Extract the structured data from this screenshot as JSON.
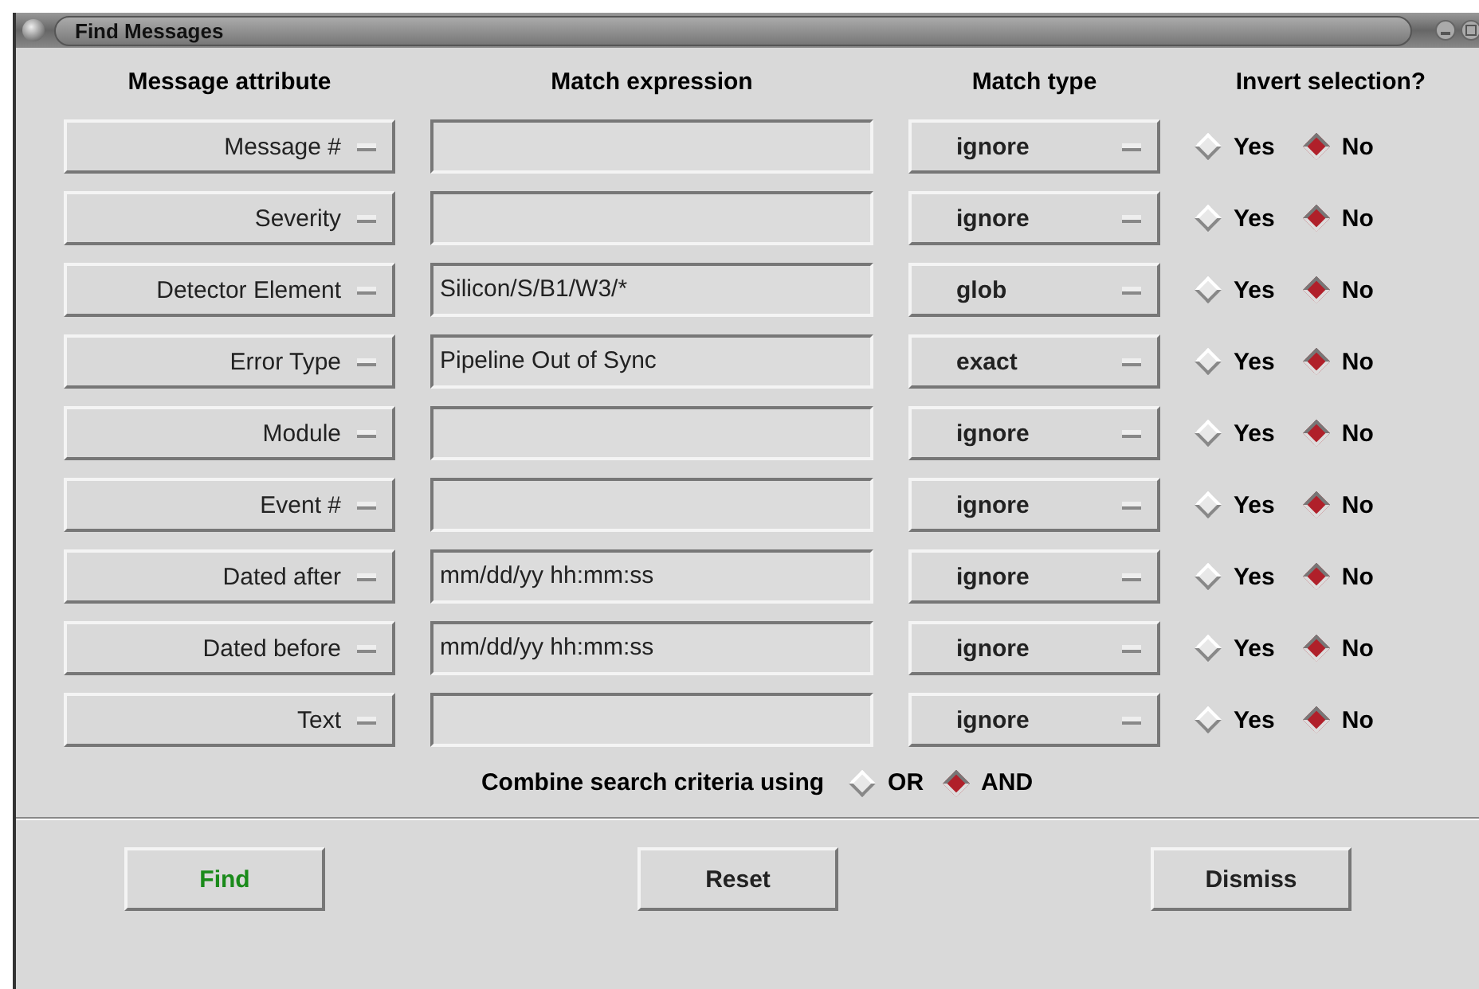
{
  "window": {
    "title": "Find Messages"
  },
  "headers": [
    "Message attribute",
    "Match expression",
    "Match type",
    "Invert selection?"
  ],
  "rows": [
    {
      "attribute": "Message #",
      "expression": "",
      "match_type": "ignore",
      "invert": [
        {
          "label": "Yes",
          "selected": false
        },
        {
          "label": "No",
          "selected": true
        }
      ]
    },
    {
      "attribute": "Severity",
      "expression": "",
      "match_type": "ignore",
      "invert": [
        {
          "label": "Yes",
          "selected": false
        },
        {
          "label": "No",
          "selected": true
        }
      ]
    },
    {
      "attribute": "Detector Element",
      "expression": "Silicon/S/B1/W3/*",
      "match_type": "glob",
      "invert": [
        {
          "label": "Yes",
          "selected": false
        },
        {
          "label": "No",
          "selected": true
        }
      ]
    },
    {
      "attribute": "Error Type",
      "expression": "Pipeline Out of Sync",
      "match_type": "exact",
      "invert": [
        {
          "label": "Yes",
          "selected": false
        },
        {
          "label": "No",
          "selected": true
        }
      ]
    },
    {
      "attribute": "Module",
      "expression": "",
      "match_type": "ignore",
      "invert": [
        {
          "label": "Yes",
          "selected": false
        },
        {
          "label": "No",
          "selected": true
        }
      ]
    },
    {
      "attribute": "Event #",
      "expression": "",
      "match_type": "ignore",
      "invert": [
        {
          "label": "Yes",
          "selected": false
        },
        {
          "label": "No",
          "selected": true
        }
      ]
    },
    {
      "attribute": "Dated after",
      "expression": "mm/dd/yy hh:mm:ss",
      "match_type": "ignore",
      "invert": [
        {
          "label": "Yes",
          "selected": false
        },
        {
          "label": "No",
          "selected": true
        }
      ]
    },
    {
      "attribute": "Dated before",
      "expression": "mm/dd/yy hh:mm:ss",
      "match_type": "ignore",
      "invert": [
        {
          "label": "Yes",
          "selected": false
        },
        {
          "label": "No",
          "selected": true
        }
      ]
    },
    {
      "attribute": "Text",
      "expression": "",
      "match_type": "ignore",
      "invert": [
        {
          "label": "Yes",
          "selected": false
        },
        {
          "label": "No",
          "selected": true
        }
      ]
    }
  ],
  "combine": {
    "label": "Combine search criteria using",
    "options": [
      {
        "label": "OR",
        "selected": false
      },
      {
        "label": "AND",
        "selected": true
      }
    ]
  },
  "buttons": [
    {
      "label": "Find",
      "default": true
    },
    {
      "label": "Reset",
      "default": false
    },
    {
      "label": "Dismiss",
      "default": false
    }
  ]
}
